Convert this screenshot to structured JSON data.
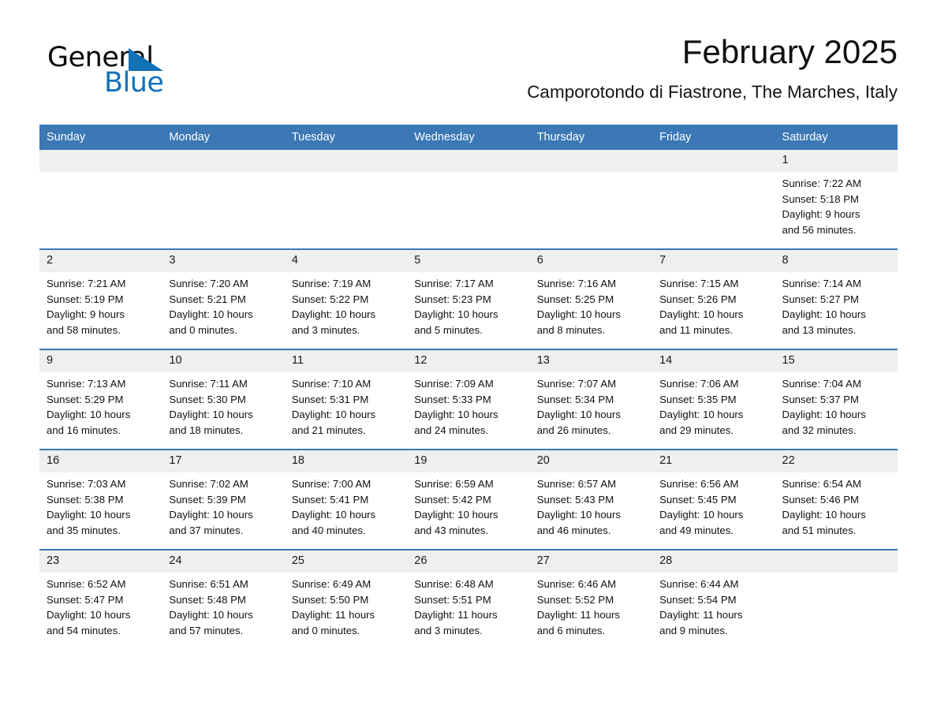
{
  "logo": {
    "word_one": "General",
    "word_two": "Blue",
    "triangle_color": "#1272b8"
  },
  "header": {
    "title": "February 2025",
    "subtitle": "Camporotondo di Fiastrone, The Marches, Italy"
  },
  "theme": {
    "header_blue": "#3b78b5",
    "daynum_bg": "#efefef",
    "page_bg": "#ffffff"
  },
  "calendar": {
    "weekday_headers": [
      "Sunday",
      "Monday",
      "Tuesday",
      "Wednesday",
      "Thursday",
      "Friday",
      "Saturday"
    ],
    "weeks": [
      [
        {
          "day": "",
          "lines": []
        },
        {
          "day": "",
          "lines": []
        },
        {
          "day": "",
          "lines": []
        },
        {
          "day": "",
          "lines": []
        },
        {
          "day": "",
          "lines": []
        },
        {
          "day": "",
          "lines": []
        },
        {
          "day": "1",
          "lines": [
            "Sunrise: 7:22 AM",
            "Sunset: 5:18 PM",
            "Daylight: 9 hours",
            "and 56 minutes."
          ]
        }
      ],
      [
        {
          "day": "2",
          "lines": [
            "Sunrise: 7:21 AM",
            "Sunset: 5:19 PM",
            "Daylight: 9 hours",
            "and 58 minutes."
          ]
        },
        {
          "day": "3",
          "lines": [
            "Sunrise: 7:20 AM",
            "Sunset: 5:21 PM",
            "Daylight: 10 hours",
            "and 0 minutes."
          ]
        },
        {
          "day": "4",
          "lines": [
            "Sunrise: 7:19 AM",
            "Sunset: 5:22 PM",
            "Daylight: 10 hours",
            "and 3 minutes."
          ]
        },
        {
          "day": "5",
          "lines": [
            "Sunrise: 7:17 AM",
            "Sunset: 5:23 PM",
            "Daylight: 10 hours",
            "and 5 minutes."
          ]
        },
        {
          "day": "6",
          "lines": [
            "Sunrise: 7:16 AM",
            "Sunset: 5:25 PM",
            "Daylight: 10 hours",
            "and 8 minutes."
          ]
        },
        {
          "day": "7",
          "lines": [
            "Sunrise: 7:15 AM",
            "Sunset: 5:26 PM",
            "Daylight: 10 hours",
            "and 11 minutes."
          ]
        },
        {
          "day": "8",
          "lines": [
            "Sunrise: 7:14 AM",
            "Sunset: 5:27 PM",
            "Daylight: 10 hours",
            "and 13 minutes."
          ]
        }
      ],
      [
        {
          "day": "9",
          "lines": [
            "Sunrise: 7:13 AM",
            "Sunset: 5:29 PM",
            "Daylight: 10 hours",
            "and 16 minutes."
          ]
        },
        {
          "day": "10",
          "lines": [
            "Sunrise: 7:11 AM",
            "Sunset: 5:30 PM",
            "Daylight: 10 hours",
            "and 18 minutes."
          ]
        },
        {
          "day": "11",
          "lines": [
            "Sunrise: 7:10 AM",
            "Sunset: 5:31 PM",
            "Daylight: 10 hours",
            "and 21 minutes."
          ]
        },
        {
          "day": "12",
          "lines": [
            "Sunrise: 7:09 AM",
            "Sunset: 5:33 PM",
            "Daylight: 10 hours",
            "and 24 minutes."
          ]
        },
        {
          "day": "13",
          "lines": [
            "Sunrise: 7:07 AM",
            "Sunset: 5:34 PM",
            "Daylight: 10 hours",
            "and 26 minutes."
          ]
        },
        {
          "day": "14",
          "lines": [
            "Sunrise: 7:06 AM",
            "Sunset: 5:35 PM",
            "Daylight: 10 hours",
            "and 29 minutes."
          ]
        },
        {
          "day": "15",
          "lines": [
            "Sunrise: 7:04 AM",
            "Sunset: 5:37 PM",
            "Daylight: 10 hours",
            "and 32 minutes."
          ]
        }
      ],
      [
        {
          "day": "16",
          "lines": [
            "Sunrise: 7:03 AM",
            "Sunset: 5:38 PM",
            "Daylight: 10 hours",
            "and 35 minutes."
          ]
        },
        {
          "day": "17",
          "lines": [
            "Sunrise: 7:02 AM",
            "Sunset: 5:39 PM",
            "Daylight: 10 hours",
            "and 37 minutes."
          ]
        },
        {
          "day": "18",
          "lines": [
            "Sunrise: 7:00 AM",
            "Sunset: 5:41 PM",
            "Daylight: 10 hours",
            "and 40 minutes."
          ]
        },
        {
          "day": "19",
          "lines": [
            "Sunrise: 6:59 AM",
            "Sunset: 5:42 PM",
            "Daylight: 10 hours",
            "and 43 minutes."
          ]
        },
        {
          "day": "20",
          "lines": [
            "Sunrise: 6:57 AM",
            "Sunset: 5:43 PM",
            "Daylight: 10 hours",
            "and 46 minutes."
          ]
        },
        {
          "day": "21",
          "lines": [
            "Sunrise: 6:56 AM",
            "Sunset: 5:45 PM",
            "Daylight: 10 hours",
            "and 49 minutes."
          ]
        },
        {
          "day": "22",
          "lines": [
            "Sunrise: 6:54 AM",
            "Sunset: 5:46 PM",
            "Daylight: 10 hours",
            "and 51 minutes."
          ]
        }
      ],
      [
        {
          "day": "23",
          "lines": [
            "Sunrise: 6:52 AM",
            "Sunset: 5:47 PM",
            "Daylight: 10 hours",
            "and 54 minutes."
          ]
        },
        {
          "day": "24",
          "lines": [
            "Sunrise: 6:51 AM",
            "Sunset: 5:48 PM",
            "Daylight: 10 hours",
            "and 57 minutes."
          ]
        },
        {
          "day": "25",
          "lines": [
            "Sunrise: 6:49 AM",
            "Sunset: 5:50 PM",
            "Daylight: 11 hours",
            "and 0 minutes."
          ]
        },
        {
          "day": "26",
          "lines": [
            "Sunrise: 6:48 AM",
            "Sunset: 5:51 PM",
            "Daylight: 11 hours",
            "and 3 minutes."
          ]
        },
        {
          "day": "27",
          "lines": [
            "Sunrise: 6:46 AM",
            "Sunset: 5:52 PM",
            "Daylight: 11 hours",
            "and 6 minutes."
          ]
        },
        {
          "day": "28",
          "lines": [
            "Sunrise: 6:44 AM",
            "Sunset: 5:54 PM",
            "Daylight: 11 hours",
            "and 9 minutes."
          ]
        },
        {
          "day": "",
          "lines": []
        }
      ]
    ]
  }
}
